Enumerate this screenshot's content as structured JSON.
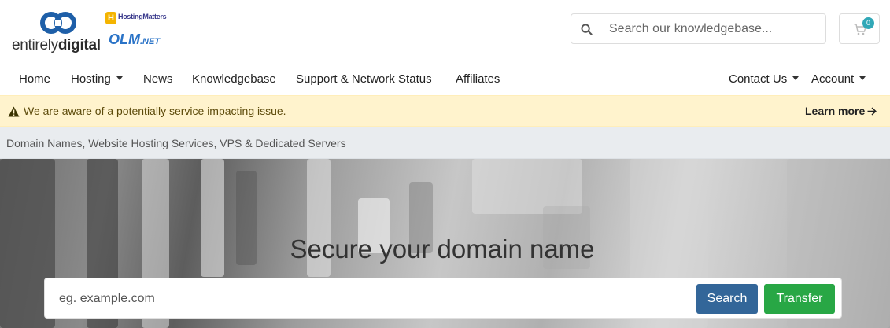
{
  "brand": {
    "primary_logo_light": "entirely",
    "primary_logo_bold": "digital",
    "partner_logo_top": "HostingMatters",
    "partner_logo_main": "OLM",
    "partner_logo_suffix": ".NET"
  },
  "search": {
    "placeholder": "Search our knowledgebase..."
  },
  "cart": {
    "count": "0"
  },
  "nav": {
    "home": "Home",
    "hosting": "Hosting",
    "news": "News",
    "knowledgebase": "Knowledgebase",
    "support": "Support & Network Status",
    "affiliates": "Affiliates",
    "contact": "Contact Us",
    "account": "Account"
  },
  "alert": {
    "message": "We are aware of a potentially service impacting issue.",
    "link": "Learn more"
  },
  "breadcrumb": {
    "text": "Domain Names, Website Hosting Services, VPS & Dedicated Servers"
  },
  "hero": {
    "headline": "Secure your domain name",
    "domain_placeholder": "eg. example.com",
    "search_button": "Search",
    "transfer_button": "Transfer"
  },
  "colors": {
    "alert_bg": "#fff3cd",
    "search_button": "#336699",
    "transfer_button": "#28a745",
    "cart_badge": "#31a8b7"
  }
}
